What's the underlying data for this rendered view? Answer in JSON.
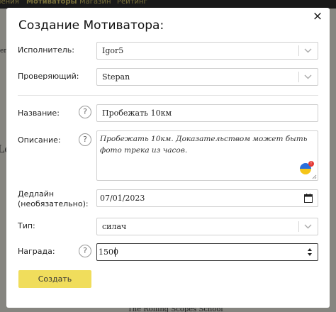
{
  "background": {
    "nav_items": [
      "Ления",
      "Мотиваторы",
      "Магазин",
      "Рейтинг"
    ],
    "footer_text": "The Rolling Scopes School",
    "left_fragments": [
      "ег",
      "Le"
    ]
  },
  "modal": {
    "title": "Создание Мотиватора:",
    "close_label": "×",
    "help_symbol": "?",
    "fields": {
      "executor": {
        "label": "Исполнитель:",
        "value": "Igor5"
      },
      "reviewer": {
        "label": "Проверяющий:",
        "value": "Stepan"
      },
      "name": {
        "label": "Название:",
        "value": "Пробежать 10км"
      },
      "description": {
        "label": "Описание:",
        "value": "Пробежать 10км. Доказательством может быть фото трека из часов."
      },
      "deadline": {
        "label_line1": "Дедлайн",
        "label_line2": "(необязательно):",
        "value": "07/01/2023"
      },
      "type": {
        "label": "Тип:",
        "value": "силач"
      },
      "reward": {
        "label": "Награда:",
        "value": "1500"
      }
    },
    "extension_badge": "!",
    "submit_label": "Создать"
  },
  "colors": {
    "accent": "#f0dd5c",
    "overlay": "#000000",
    "nav_bar": "#2f2f2f"
  }
}
